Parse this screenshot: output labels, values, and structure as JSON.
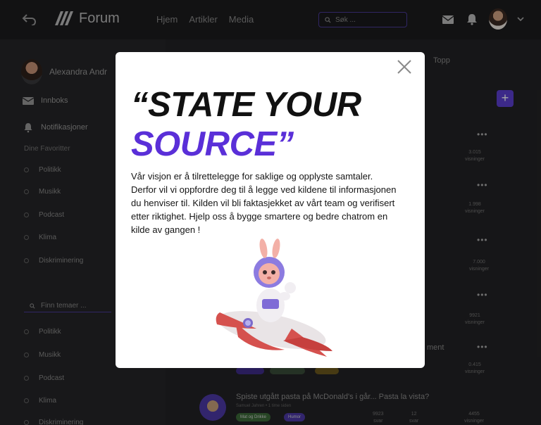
{
  "topbar": {
    "app_name": "Forum",
    "nav": [
      "Hjem",
      "Artikler",
      "Media"
    ],
    "search_placeholder": "Søk ..."
  },
  "sidebar": {
    "profile_name": "Alexandra Andr",
    "items": [
      {
        "label": "Innboks",
        "icon": "inbox-icon"
      },
      {
        "label": "Notifikasjoner",
        "icon": "bell-icon"
      }
    ],
    "favorites_title": "Dine Favoritter",
    "favorites": [
      "Politikk",
      "Musikk",
      "Podcast",
      "Klima",
      "Diskriminering"
    ],
    "topic_search_placeholder": "Finn temaer ...",
    "topics": [
      "Politikk",
      "Musikk",
      "Podcast",
      "Klima",
      "Diskriminering"
    ]
  },
  "main": {
    "tab_top": "Topp",
    "post_partial_title": "ment",
    "stats": [
      {
        "value": "3.015",
        "label": "visninger"
      },
      {
        "value": "1.998",
        "label": "visninger"
      },
      {
        "value": "7.000",
        "label": "visninger"
      },
      {
        "value": "9921",
        "label": "visninger"
      },
      {
        "value": "0.415",
        "label": "visninger"
      }
    ],
    "post": {
      "title": "Spiste utgått pasta på McDonald's i går... Pasta la vista?",
      "author": "Samuel Jahren • 1 time siden",
      "tags": [
        "Mat og Drikke",
        "Humor"
      ],
      "stats": [
        {
          "value": "9923",
          "label": "svar"
        },
        {
          "value": "12",
          "label": "svar"
        },
        {
          "value": "4455",
          "label": "visninger"
        }
      ]
    }
  },
  "modal": {
    "headline_line1": "“STATE  YOUR",
    "headline_line2": "SOURCE”",
    "body": "Vår visjon er å tilrettelegge for saklige og opplyste samtaler. Derfor vil vi oppfordre deg til å legge ved kildene til informasjonen du henviser til. Kilden vil bli faktasjekket av vårt team og verifisert etter riktighet. Hjelp oss å bygge smartere og bedre chatrom en kilde av gangen !",
    "close_icon": "close-icon",
    "illustration": "bunny-astronaut-on-rocket"
  },
  "colors": {
    "accent": "#5a2fd8",
    "background": "#242426",
    "modal_bg": "#ffffff"
  }
}
